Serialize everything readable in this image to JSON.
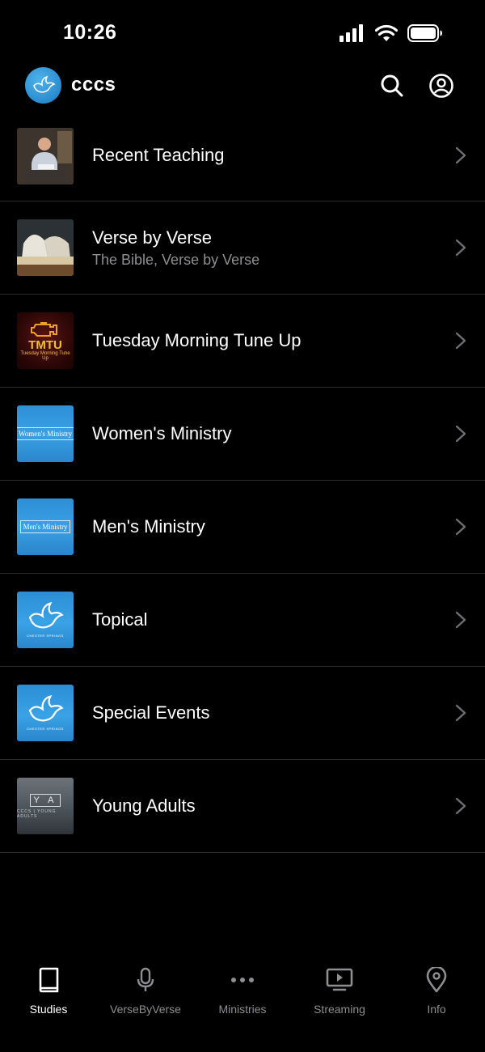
{
  "status_bar": {
    "time": "10:26",
    "icons": [
      "signal-icon",
      "wifi-icon",
      "battery-icon"
    ]
  },
  "app_bar": {
    "title": "cccs",
    "actions": [
      "search-icon",
      "account-icon"
    ]
  },
  "rows": [
    {
      "title": "Recent Teaching",
      "subtitle": "",
      "thumbnail": "teacher-photo"
    },
    {
      "title": "Verse by Verse",
      "subtitle": "The Bible, Verse by Verse",
      "thumbnail": "open-bible-photo"
    },
    {
      "title": "Tuesday Morning Tune Up",
      "subtitle": "",
      "thumbnail": "tmtu-logo",
      "thumb_text": "TMTU",
      "thumb_sub": "Tuesday Morning Tune Up"
    },
    {
      "title": "Women's Ministry",
      "subtitle": "",
      "thumbnail": "ocean-label",
      "thumb_text": "Women's Ministry"
    },
    {
      "title": "Men's Ministry",
      "subtitle": "",
      "thumbnail": "ocean-label",
      "thumb_text": "Men's Ministry"
    },
    {
      "title": "Topical",
      "subtitle": "",
      "thumbnail": "dove-logo",
      "thumb_sub": "CHESTER SPRINGS"
    },
    {
      "title": "Special Events",
      "subtitle": "",
      "thumbnail": "dove-logo",
      "thumb_sub": "CHESTER SPRINGS"
    },
    {
      "title": "Young Adults",
      "subtitle": "",
      "thumbnail": "ya-logo",
      "thumb_text": "Y A",
      "thumb_sub": "CCCS | YOUNG ADULTS"
    }
  ],
  "tabs": [
    {
      "label": "Studies",
      "icon": "book-icon",
      "active": true
    },
    {
      "label": "VerseByVerse",
      "icon": "microphone-icon",
      "active": false
    },
    {
      "label": "Ministries",
      "icon": "more-dots-icon",
      "active": false
    },
    {
      "label": "Streaming",
      "icon": "tv-play-icon",
      "active": false
    },
    {
      "label": "Info",
      "icon": "location-pin-icon",
      "active": false
    }
  ],
  "colors": {
    "background": "#000000",
    "text": "#ffffff",
    "secondary_text": "#8d8d92",
    "divider": "#2a2a2c",
    "brand_blue": "#2f95d8"
  }
}
